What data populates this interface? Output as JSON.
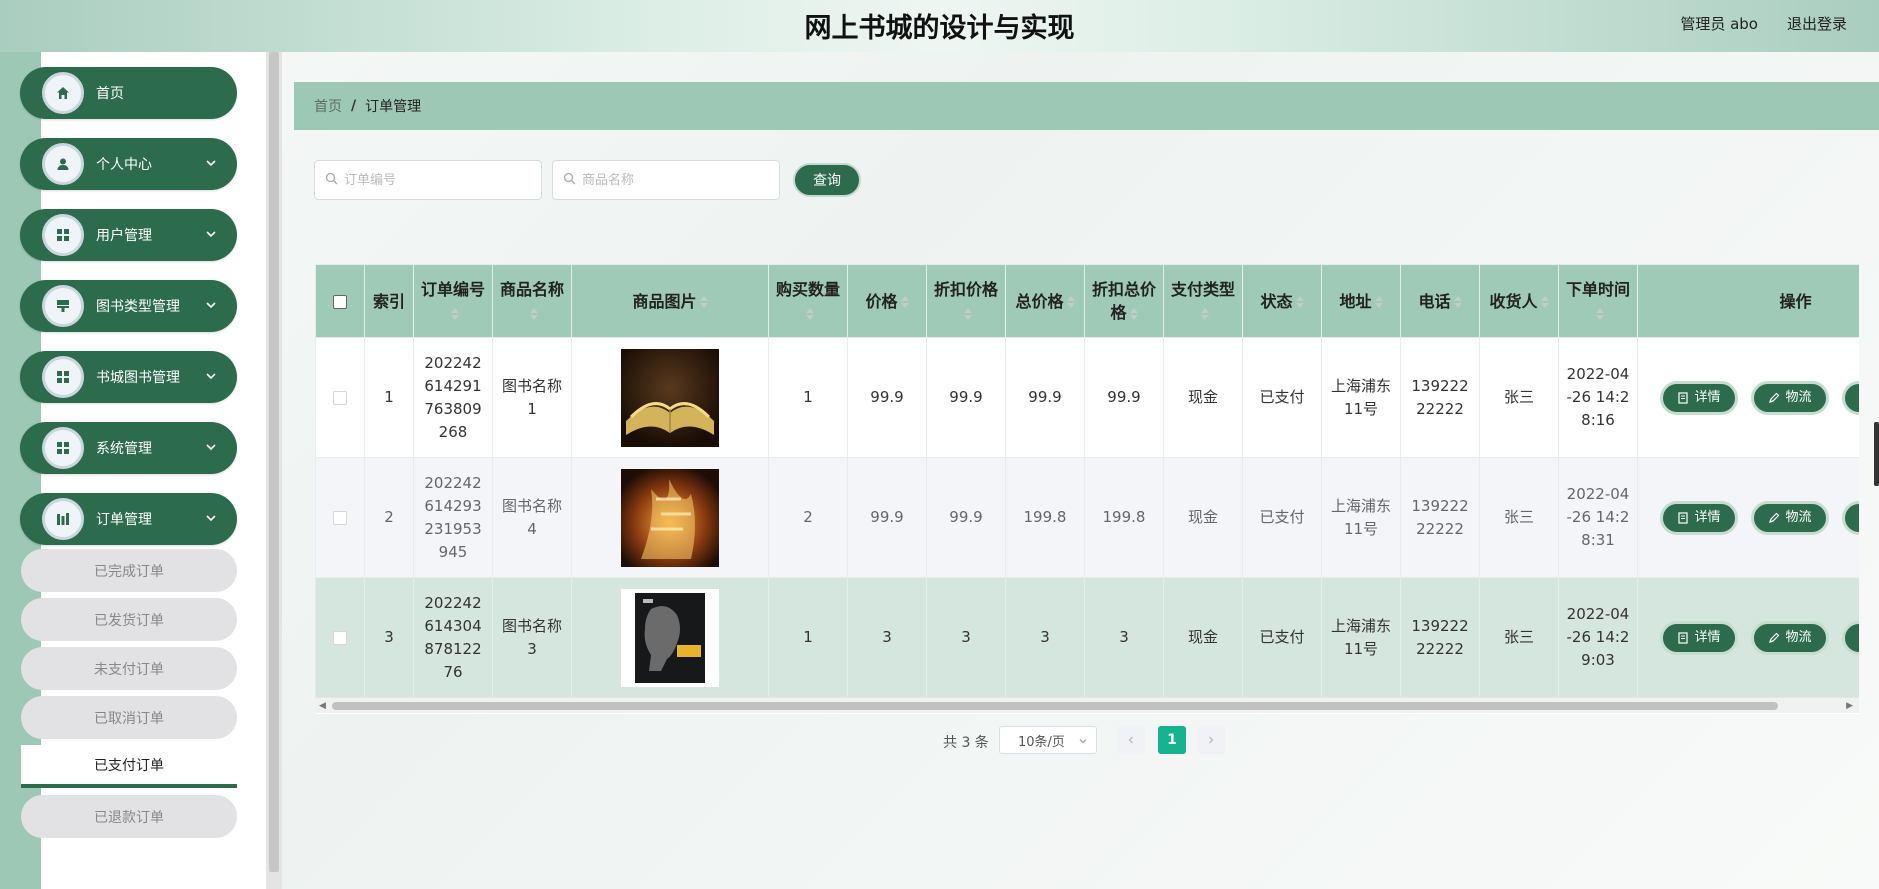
{
  "header": {
    "title": "网上书城的设计与实现",
    "user": "管理员 abo",
    "logout": "退出登录"
  },
  "sidebar": {
    "items": [
      {
        "label": "首页",
        "icon": "home-icon"
      },
      {
        "label": "个人中心",
        "icon": "user-icon"
      },
      {
        "label": "用户管理",
        "icon": "grid-icon"
      },
      {
        "label": "图书类型管理",
        "icon": "stamp-icon"
      },
      {
        "label": "书城图书管理",
        "icon": "grid-icon"
      },
      {
        "label": "系统管理",
        "icon": "grid-icon"
      },
      {
        "label": "订单管理",
        "icon": "chart-icon"
      }
    ],
    "sub_items": [
      {
        "label": "已完成订单"
      },
      {
        "label": "已发货订单"
      },
      {
        "label": "未支付订单"
      },
      {
        "label": "已取消订单"
      },
      {
        "label": "已支付订单"
      },
      {
        "label": "已退款订单"
      }
    ]
  },
  "breadcrumb": {
    "home": "首页",
    "separator": "/",
    "current": "订单管理"
  },
  "search": {
    "order_no_placeholder": "订单编号",
    "product_name_placeholder": "商品名称",
    "query_label": "查询"
  },
  "table": {
    "headers": [
      "索引",
      "订单编号",
      "商品名称",
      "商品图片",
      "购买数量",
      "价格",
      "折扣价格",
      "总价格",
      "折扣总价格",
      "支付类型",
      "状态",
      "地址",
      "电话",
      "收货人",
      "下单时间",
      "操作"
    ],
    "rows": [
      {
        "index": "1",
        "order_no": "202242614291763809268",
        "name": "图书名称1",
        "qty": "1",
        "price": "99.9",
        "discount_price": "99.9",
        "total": "99.9",
        "discount_total": "99.9",
        "pay_type": "现金",
        "status": "已支付",
        "address": "上海浦东11号",
        "phone": "13922222222",
        "receiver": "张三",
        "time": "2022-04-26 14:28:16"
      },
      {
        "index": "2",
        "order_no": "202242614293231953945",
        "name": "图书名称4",
        "qty": "2",
        "price": "99.9",
        "discount_price": "99.9",
        "total": "199.8",
        "discount_total": "199.8",
        "pay_type": "现金",
        "status": "已支付",
        "address": "上海浦东11号",
        "phone": "13922222222",
        "receiver": "张三",
        "time": "2022-04-26 14:28:31"
      },
      {
        "index": "3",
        "order_no": "20224261430487812276",
        "name": "图书名称3",
        "qty": "1",
        "price": "3",
        "discount_price": "3",
        "total": "3",
        "discount_total": "3",
        "pay_type": "现金",
        "status": "已支付",
        "address": "上海浦东11号",
        "phone": "13922222222",
        "receiver": "张三",
        "time": "2022-04-26 14:29:03"
      }
    ],
    "actions": {
      "detail": "详情",
      "logistics": "物流"
    }
  },
  "pagination": {
    "total": "共 3 条",
    "page_size": "10条/页",
    "current_page": "1"
  },
  "colors": {
    "primary": "#2c6b4c",
    "header_green": "#a0cab8",
    "page_active": "#17b290"
  }
}
